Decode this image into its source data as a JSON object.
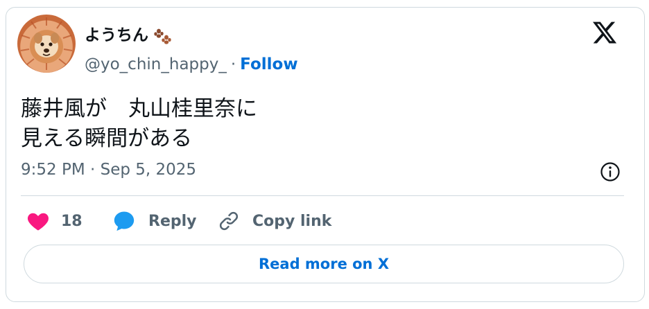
{
  "author": {
    "display_name": "ようちん",
    "name_emoji_icon": "paw-prints-icon",
    "handle": "@yo_chin_happy_",
    "separator": "·",
    "follow_label": "Follow",
    "avatar_icon": "dog-in-lion-mane-avatar"
  },
  "brand_icon": "x-logo-icon",
  "tweet": {
    "text": "藤井風が　丸山桂里奈に\n見える瞬間がある",
    "timestamp": "9:52 PM · Sep 5, 2025"
  },
  "actions": {
    "like_count": "18",
    "reply_label": "Reply",
    "copy_link_label": "Copy link"
  },
  "read_more_label": "Read more on X",
  "colors": {
    "like_pink": "#f91880",
    "reply_blue": "#1d9bf0",
    "link_blue": "#006fd6",
    "muted_text": "#536471",
    "border": "#cfd9de"
  }
}
